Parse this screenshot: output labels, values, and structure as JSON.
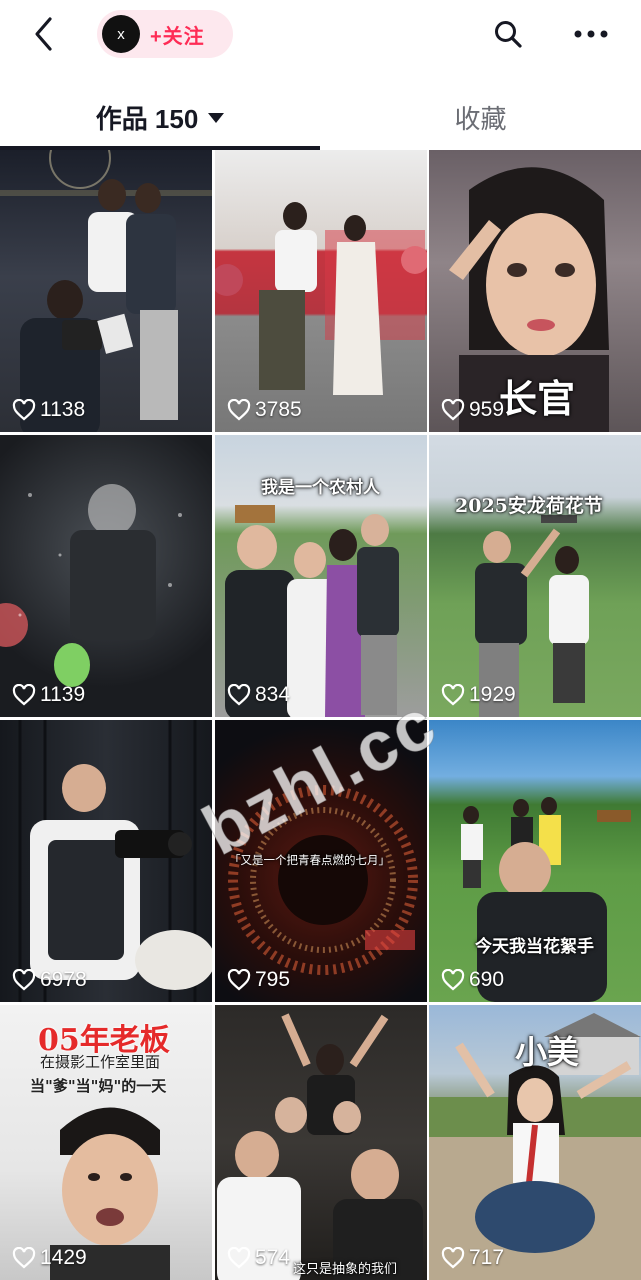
{
  "header": {
    "avatar_letter": "x",
    "follow_label": "+关注",
    "icons": [
      "back-arrow-icon",
      "search-icon",
      "more-dots-icon"
    ]
  },
  "tabs": [
    {
      "label": "作品 150",
      "active": true
    },
    {
      "label": "收藏",
      "active": false
    }
  ],
  "videos": [
    {
      "likes": "1138"
    },
    {
      "likes": "3785"
    },
    {
      "likes": "959",
      "caption": "长官"
    },
    {
      "likes": "1139"
    },
    {
      "likes": "834",
      "caption": "我是一个农村人"
    },
    {
      "likes": "1929",
      "caption": "2025安龙荷花节"
    },
    {
      "likes": "6978"
    },
    {
      "likes": "795",
      "caption": "「又是一个把青春点燃的七月」"
    },
    {
      "likes": "690",
      "caption": "今天我当花絮手"
    },
    {
      "likes": "1429",
      "caption": "05年老板",
      "subcaption1": "在摄影工作室里面",
      "subcaption2": "当\"爹\"当\"妈\"的一天"
    },
    {
      "likes": "574",
      "caption": "这只是抽象的我们"
    },
    {
      "likes": "717",
      "caption": "小美"
    }
  ],
  "watermark": "bzhl.cc",
  "colors": {
    "accent": "#fe2c55",
    "pill_bg": "#fde8ee",
    "text": "#161823"
  }
}
